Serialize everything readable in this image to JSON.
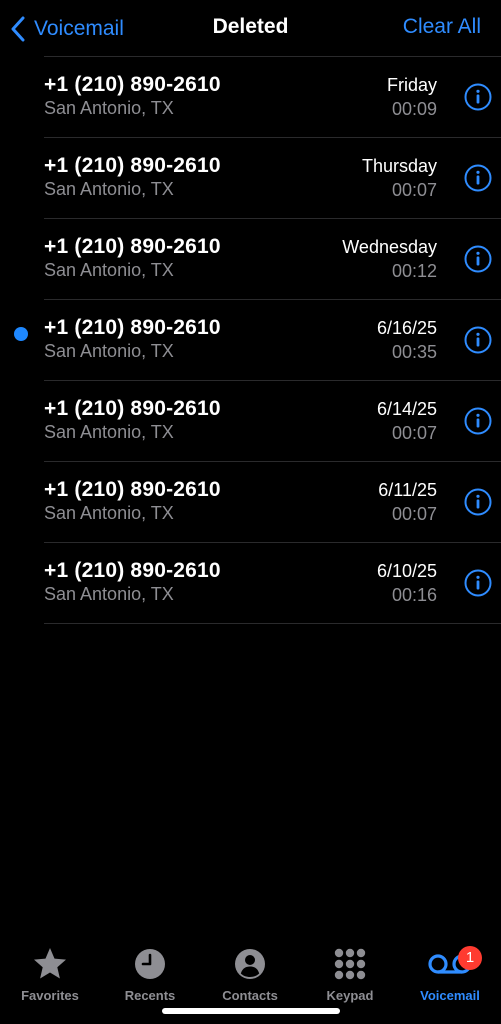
{
  "nav": {
    "back_label": "Voicemail",
    "title": "Deleted",
    "clear_label": "Clear All"
  },
  "voicemails": [
    {
      "number": "+1 (210) 890-2610",
      "location": "San Antonio, TX",
      "date": "Friday",
      "duration": "00:09",
      "unread": false
    },
    {
      "number": "+1 (210) 890-2610",
      "location": "San Antonio, TX",
      "date": "Thursday",
      "duration": "00:07",
      "unread": false
    },
    {
      "number": "+1 (210) 890-2610",
      "location": "San Antonio, TX",
      "date": "Wednesday",
      "duration": "00:12",
      "unread": false
    },
    {
      "number": "+1 (210) 890-2610",
      "location": "San Antonio, TX",
      "date": "6/16/25",
      "duration": "00:35",
      "unread": true
    },
    {
      "number": "+1 (210) 890-2610",
      "location": "San Antonio, TX",
      "date": "6/14/25",
      "duration": "00:07",
      "unread": false
    },
    {
      "number": "+1 (210) 890-2610",
      "location": "San Antonio, TX",
      "date": "6/11/25",
      "duration": "00:07",
      "unread": false
    },
    {
      "number": "+1 (210) 890-2610",
      "location": "San Antonio, TX",
      "date": "6/10/25",
      "duration": "00:16",
      "unread": false
    }
  ],
  "tabbar": {
    "favorites": "Favorites",
    "recents": "Recents",
    "contacts": "Contacts",
    "keypad": "Keypad",
    "voicemail": "Voicemail",
    "voicemail_badge": "1"
  },
  "colors": {
    "accent": "#2f8cff",
    "unread_dot": "#1e88ff",
    "badge": "#ff3b30",
    "secondary": "#8e8e93"
  }
}
